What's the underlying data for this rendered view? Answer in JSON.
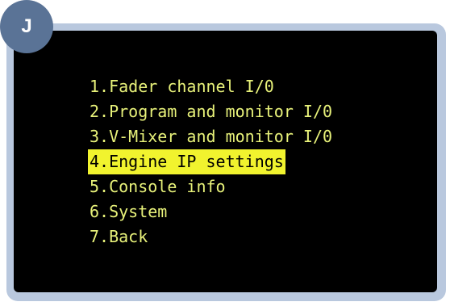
{
  "badge": {
    "letter": "J"
  },
  "menu": {
    "selected_index": 3,
    "items": [
      {
        "label": "1.Fader channel I/0"
      },
      {
        "label": "2.Program and monitor I/0"
      },
      {
        "label": "3.V-Mixer and monitor I/0"
      },
      {
        "label": "4.Engine IP settings"
      },
      {
        "label": "5.Console info"
      },
      {
        "label": "6.System"
      },
      {
        "label": "7.Back"
      }
    ]
  },
  "colors": {
    "frame": "#b9c8de",
    "screen": "#000000",
    "text": "#e8f27a",
    "highlight": "#f1f32e",
    "badge": "#5a7396"
  }
}
